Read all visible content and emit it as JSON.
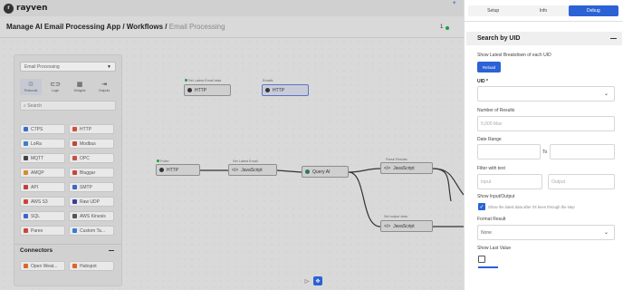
{
  "app": {
    "logo_letter": "r",
    "logo_text": "rayven"
  },
  "breadcrumb": {
    "path": "Manage AI Email Processing App / Workflows / ",
    "current": "Email Processing"
  },
  "status": {
    "count": "1",
    "color": "#1e9e3e"
  },
  "palette": {
    "selected_workflow": "Email Processing",
    "categories": [
      {
        "label": "Protocols",
        "icon": "protocols-icon"
      },
      {
        "label": "Logic",
        "icon": "link-icon"
      },
      {
        "label": "Widgets",
        "icon": "widget-icon"
      },
      {
        "label": "Outputs",
        "icon": "output-icon"
      }
    ],
    "search_placeholder": "Search",
    "nodes": [
      {
        "label": "CTPS",
        "color": "#3b6ec9"
      },
      {
        "label": "HTTP",
        "color": "#d44f3a"
      },
      {
        "label": "LoRa",
        "color": "#3d7ec6"
      },
      {
        "label": "Modbus",
        "color": "#c0463a"
      },
      {
        "label": "MQTT",
        "color": "#444444"
      },
      {
        "label": "OPC",
        "color": "#c94f46"
      },
      {
        "label": "AMQP",
        "color": "#d48b2e"
      },
      {
        "label": "Bluggar",
        "color": "#c9453a"
      },
      {
        "label": "API",
        "color": "#c04040"
      },
      {
        "label": "SMTP",
        "color": "#3d66c9"
      },
      {
        "label": "AWS S3",
        "color": "#c9463a"
      },
      {
        "label": "Raw UDP",
        "color": "#3a3f95"
      },
      {
        "label": "SQL",
        "color": "#3d66c9"
      },
      {
        "label": "AWS Kinesis",
        "color": "#555555"
      },
      {
        "label": "Pareo",
        "color": "#c9463a"
      },
      {
        "label": "Custom Ta...",
        "color": "#3a7bd5"
      }
    ],
    "connectors_title": "Connectors",
    "connectors": [
      {
        "label": "Open Weat...",
        "color": "#d46a2e"
      },
      {
        "label": "Hubspot",
        "color": "#e0632e"
      }
    ]
  },
  "workflow": {
    "nodes": [
      {
        "id": "http-a",
        "label": "HTTP",
        "caption": "Set Latest Email data"
      },
      {
        "id": "http-b",
        "label": "HTTP",
        "caption": "Emails"
      },
      {
        "id": "http-c",
        "label": "HTTP",
        "caption": "Poller"
      },
      {
        "id": "js-a",
        "label": "JavaScript",
        "caption": "Set Latest Email"
      },
      {
        "id": "ai-a",
        "label": "Query AI",
        "caption": ""
      },
      {
        "id": "js-b",
        "label": "JavaScript",
        "caption": "Parse Results"
      },
      {
        "id": "js-c",
        "label": "JavaScript",
        "caption": "Set output data"
      }
    ]
  },
  "toolbar": {
    "pointer_icon": "cursor-icon",
    "hand_icon": "hand-icon"
  },
  "panel": {
    "tabs": [
      "Setup",
      "Info",
      "Debug"
    ],
    "active_tab": "Debug",
    "section_title": "Search by UID",
    "show_latest_label": "Show Latest Breakdown of each UID",
    "show_latest_button": "Reload",
    "uid_label": "UID *",
    "num_results_label": "Number of Results",
    "num_results_placeholder": "5,000 Max",
    "date_range_label": "Date Range",
    "date_range_to": "To",
    "filter_label": "Filter with text",
    "filter_input_placeholder": "Input",
    "filter_output_placeholder": "Output",
    "show_io_label": "Show Input/Output",
    "show_io_checkbox_label": "Show the latest data after it's been through the step",
    "format_label": "Format Result",
    "format_value": "None",
    "show_last_label": "Show Last Value",
    "accent": "#2b62d6"
  }
}
